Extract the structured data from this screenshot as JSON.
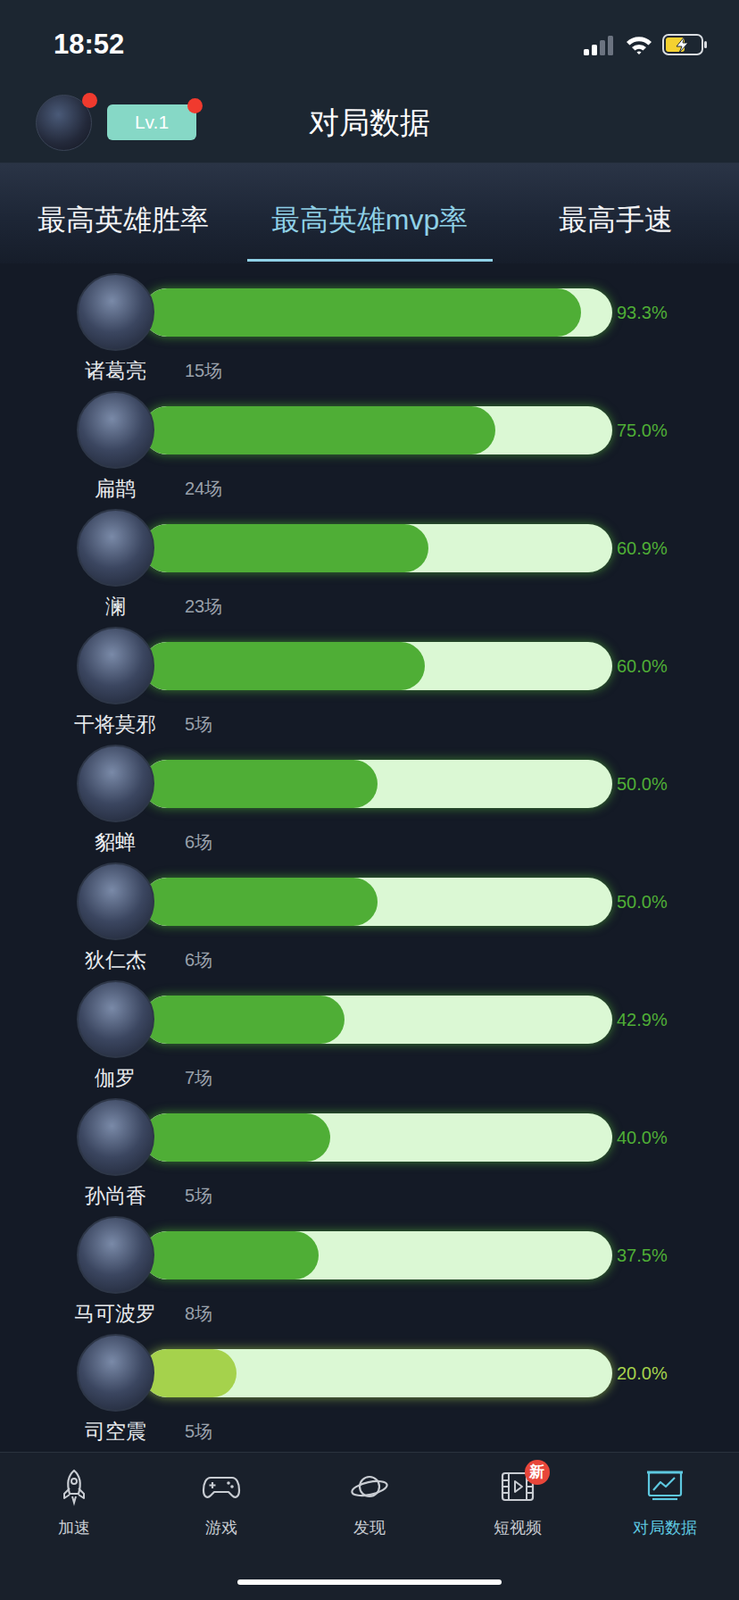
{
  "status_bar": {
    "time": "18:52",
    "signal_level": 0.5,
    "battery_level": 0.55,
    "charging": true
  },
  "header": {
    "title": "对局数据",
    "level_badge": "Lv.1",
    "avatar_notify": true,
    "badge_notify": true
  },
  "tabs": [
    {
      "label": "最高英雄胜率",
      "selected": false
    },
    {
      "label": "最高英雄mvp率",
      "selected": true
    },
    {
      "label": "最高手速",
      "selected": false
    }
  ],
  "heroes": [
    {
      "name": "诸葛亮",
      "games": "15场",
      "rate": "93.3%",
      "level": 0.933,
      "color": "#4fae36"
    },
    {
      "name": "扁鹊",
      "games": "24场",
      "rate": "75.0%",
      "level": 0.75,
      "color": "#4fae36"
    },
    {
      "name": "澜",
      "games": "23场",
      "rate": "60.9%",
      "level": 0.609,
      "color": "#4fae36"
    },
    {
      "name": "干将莫邪",
      "games": "5场",
      "rate": "60.0%",
      "level": 0.6,
      "color": "#4fae36"
    },
    {
      "name": "貂蝉",
      "games": "6场",
      "rate": "50.0%",
      "level": 0.5,
      "color": "#4fae36"
    },
    {
      "name": "狄仁杰",
      "games": "6场",
      "rate": "50.0%",
      "level": 0.5,
      "color": "#4fae36"
    },
    {
      "name": "伽罗",
      "games": "7场",
      "rate": "42.9%",
      "level": 0.429,
      "color": "#4fae36"
    },
    {
      "name": "孙尚香",
      "games": "5场",
      "rate": "40.0%",
      "level": 0.4,
      "color": "#4fae36"
    },
    {
      "name": "马可波罗",
      "games": "8场",
      "rate": "37.5%",
      "level": 0.375,
      "color": "#4fae36"
    },
    {
      "name": "司空震",
      "games": "5场",
      "rate": "20.0%",
      "level": 0.2,
      "color": "#a5d24c"
    }
  ],
  "bottom_nav": [
    {
      "label": "加速",
      "selected": false,
      "badge": ""
    },
    {
      "label": "游戏",
      "selected": false,
      "badge": ""
    },
    {
      "label": "发现",
      "selected": false,
      "badge": ""
    },
    {
      "label": "短视频",
      "selected": false,
      "badge": "新"
    },
    {
      "label": "对局数据",
      "selected": true,
      "badge": ""
    }
  ]
}
